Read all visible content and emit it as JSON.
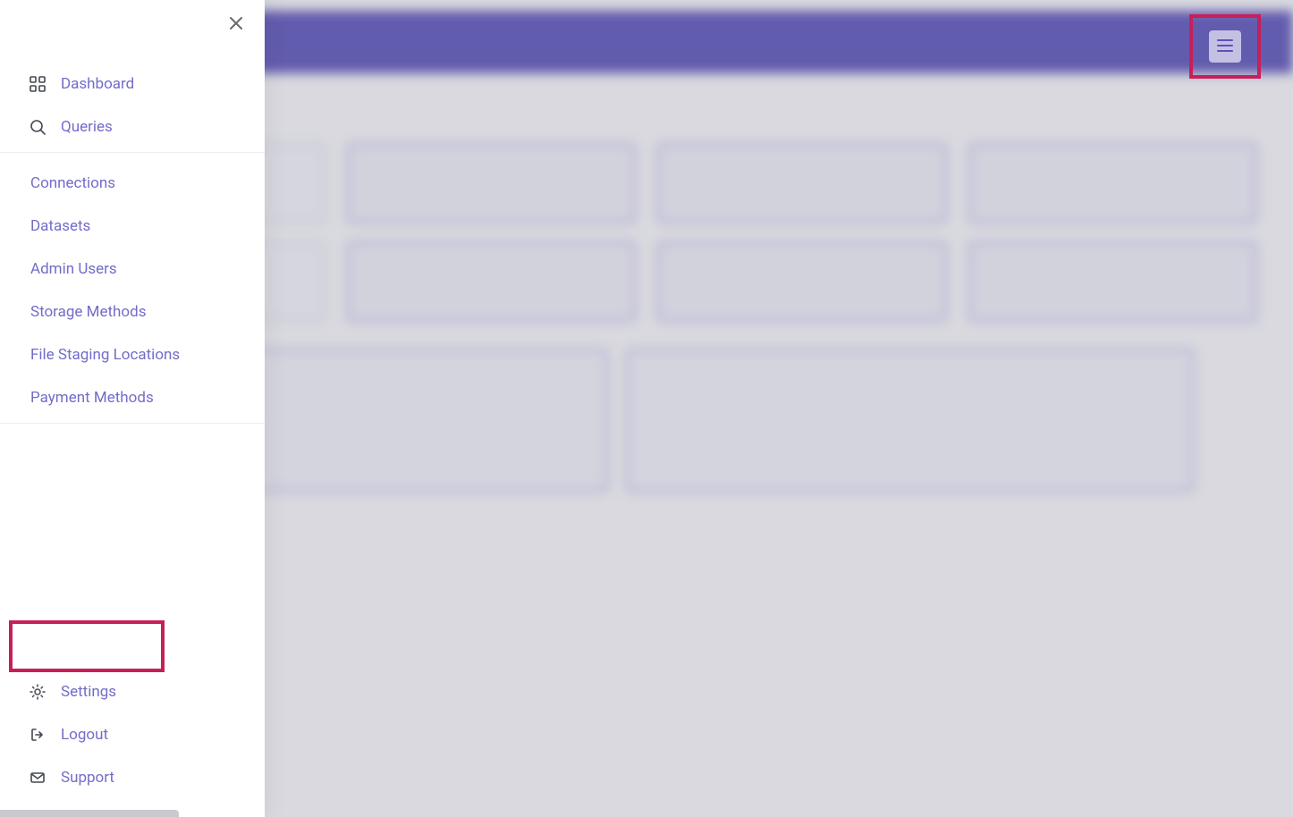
{
  "header": {
    "hamburger_icon": "menu"
  },
  "drawer": {
    "close_icon": "close",
    "top_items": [
      {
        "icon": "grid",
        "label": "Dashboard"
      },
      {
        "icon": "search",
        "label": "Queries"
      }
    ],
    "mid_items": [
      {
        "label": "Connections"
      },
      {
        "label": "Datasets"
      },
      {
        "label": "Admin Users"
      },
      {
        "label": "Storage Methods"
      },
      {
        "label": "File Staging Locations"
      },
      {
        "label": "Payment Methods"
      }
    ],
    "bottom_items": [
      {
        "icon": "gear",
        "label": "Settings"
      },
      {
        "icon": "logout",
        "label": "Logout"
      },
      {
        "icon": "mail",
        "label": "Support"
      }
    ]
  }
}
